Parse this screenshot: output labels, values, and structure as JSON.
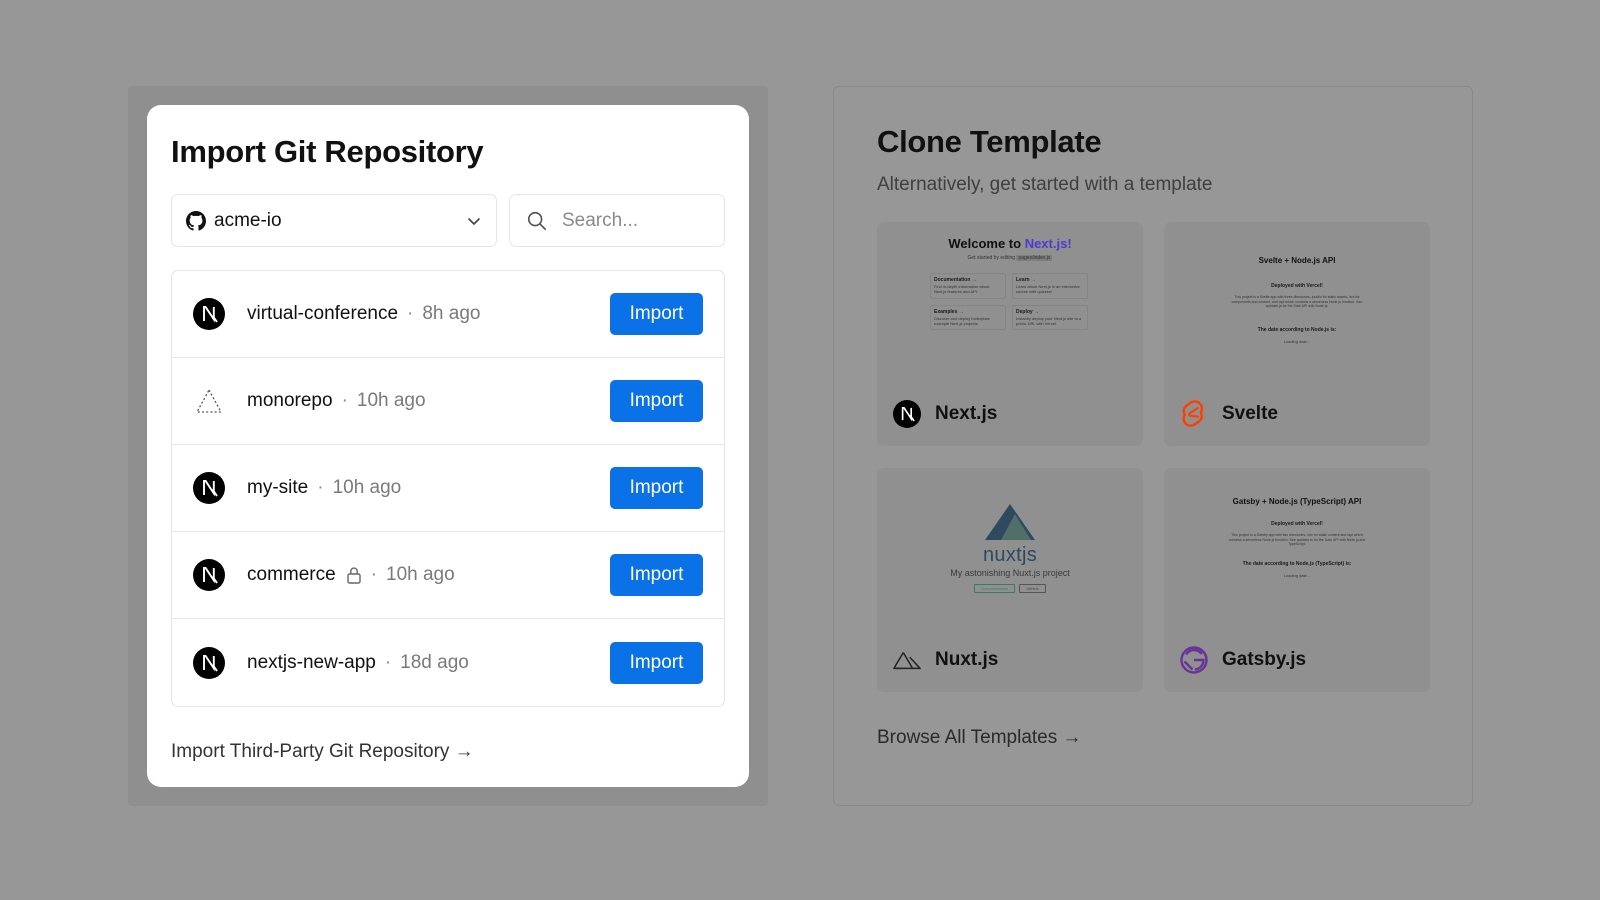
{
  "import": {
    "title": "Import Git Repository",
    "scope": {
      "label": "acme-io",
      "icon": "github-icon"
    },
    "search": {
      "placeholder": "Search..."
    },
    "repos": [
      {
        "name": "virtual-conference",
        "time": "8h ago",
        "icon": "nextjs-icon",
        "private": false,
        "button": "Import"
      },
      {
        "name": "monorepo",
        "time": "10h ago",
        "icon": "turborepo-triangle-icon",
        "private": false,
        "button": "Import"
      },
      {
        "name": "my-site",
        "time": "10h ago",
        "icon": "nextjs-icon",
        "private": false,
        "button": "Import"
      },
      {
        "name": "commerce",
        "time": "10h ago",
        "icon": "nextjs-icon",
        "private": true,
        "button": "Import"
      },
      {
        "name": "nextjs-new-app",
        "time": "18d ago",
        "icon": "nextjs-icon",
        "private": false,
        "button": "Import"
      }
    ],
    "separator": "·",
    "third_party_link": "Import Third-Party Git Repository →"
  },
  "clone": {
    "title": "Clone Template",
    "subtitle": "Alternatively, get started with a template",
    "templates": [
      {
        "name": "Next.js",
        "icon": "nextjs-icon",
        "preview": {
          "heading_prefix": "Welcome to ",
          "heading_accent": "Next.js!",
          "sub": "Get started by editing",
          "code": "pages/index.js",
          "tiles": [
            {
              "title": "Documentation →",
              "text": "Find in-depth information about Next.js features and API."
            },
            {
              "title": "Learn →",
              "text": "Learn about Next.js in an interactive course with quizzes!"
            },
            {
              "title": "Examples →",
              "text": "Discover and deploy boilerplate example Next.js projects."
            },
            {
              "title": "Deploy →",
              "text": "Instantly deploy your Next.js site to a public URL with Vercel."
            }
          ]
        }
      },
      {
        "name": "Svelte",
        "icon": "svelte-icon",
        "preview": {
          "heading": "Svelte + Node.js API",
          "deployed": "Deployed with Vercel!",
          "body": "This project is a Svelte app with three directories, /public for static assets, /src for components and content, and /api which contains a serverless Node.js function. See api/date.js for the Date API with Node.js.",
          "date_heading": "The date according to Node.js is:",
          "loading": "Loading date..."
        }
      },
      {
        "name": "Nuxt.js",
        "icon": "nuxt-icon",
        "preview": {
          "wordmark": "nuxtjs",
          "tagline": "My astonishing Nuxt.js project",
          "buttons": [
            "Documentation",
            "GitHub"
          ]
        }
      },
      {
        "name": "Gatsby.js",
        "icon": "gatsby-icon",
        "preview": {
          "heading": "Gatsby + Node.js (TypeScript) API",
          "deployed": "Deployed with Vercel!",
          "body": "This project is a Gatsby app with two directories, /src for static content and /api which contains a serverless Node.js function. See api/date.ts for the Date API with Node.js and TypeScript.",
          "date_heading": "The date according to Node.js (TypeScript) is:",
          "loading": "Loading date..."
        }
      }
    ],
    "browse_all": "Browse All Templates →"
  },
  "colors": {
    "backdrop": "#979797",
    "primary_button": "#0a72e6",
    "nextjs_accent": "#4b3bd1",
    "svelte": "#ff3e00",
    "gatsby": "#663399",
    "nuxt_dark": "#2f495e",
    "nuxt_light": "#526e68"
  }
}
